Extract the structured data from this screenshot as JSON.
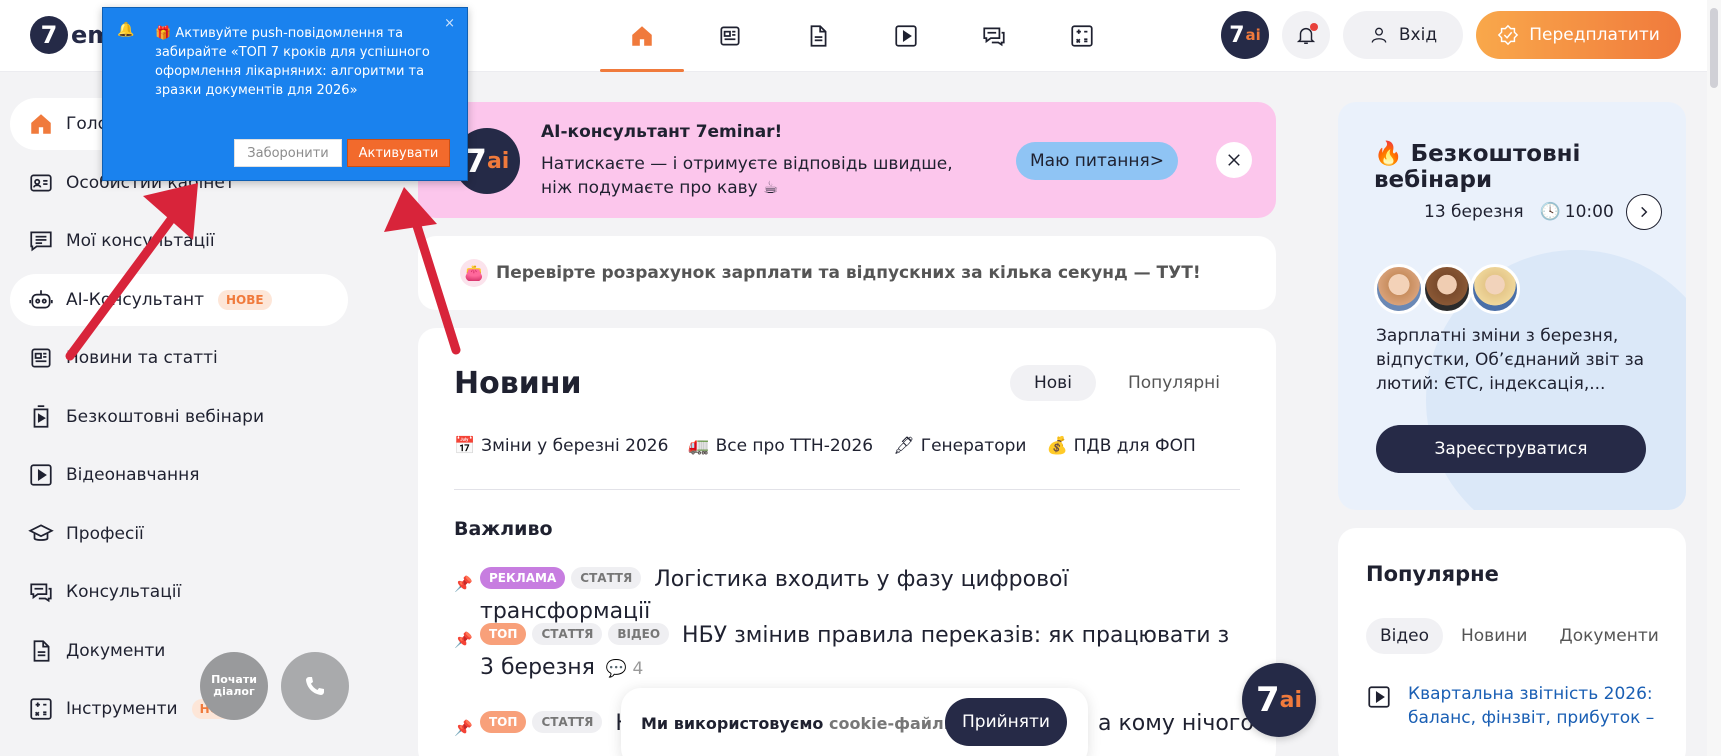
{
  "header": {
    "logo_mark": "7",
    "logo_text": "em",
    "ai_badge": "7",
    "ai_suffix": "ai",
    "login_label": "Вхід",
    "subscribe_label": "Передплатити",
    "accent": "#f07a3c"
  },
  "push": {
    "text": "🎁 Активуйте push-повідомлення та забирайте «ТОП 7 кроків для успішного оформлення лікарняних: алгоритми та зразки документів для 2026»",
    "close": "×",
    "deny": "Заборонити",
    "allow": "Активувати",
    "color": "#1a82ee"
  },
  "sidebar": {
    "items": [
      {
        "label": "Голо",
        "icon": "home-icon"
      },
      {
        "label": "Особистий кабінет",
        "icon": "id-card-icon"
      },
      {
        "label": "Мої консультації",
        "icon": "chat-list-icon"
      },
      {
        "label": "AI-Консультант",
        "icon": "robot-icon",
        "badge": "НОВЕ"
      },
      {
        "label": "Новини та статті",
        "icon": "news-icon"
      },
      {
        "label": "Безкоштовні вебінари",
        "icon": "webinar-icon"
      },
      {
        "label": "Відеонавчання",
        "icon": "video-icon"
      },
      {
        "label": "Професії",
        "icon": "graduation-icon"
      },
      {
        "label": "Консультації",
        "icon": "consult-icon"
      },
      {
        "label": "Документи",
        "icon": "document-icon"
      },
      {
        "label": "Інструменти",
        "icon": "tools-icon",
        "badge": "НОВЕ"
      }
    ]
  },
  "ai_banner": {
    "logo": "7",
    "logo_ai": "ai",
    "title": "AI-консультант 7eminar!",
    "text": "Натискаєте — і отримуєте відповідь швидше, ніж подумаєте про каву ☕",
    "button": "Маю питання>"
  },
  "calc_banner": {
    "text": "Перевірте розрахунок зарплати та відпускних за кілька секунд — ТУТ!"
  },
  "news": {
    "title": "Новини",
    "tabs": [
      "Нові",
      "Популярні"
    ],
    "topics": [
      {
        "emoji": "📅",
        "label": "Зміни у березні 2026"
      },
      {
        "emoji": "🚛",
        "label": "Все про ТТН-2026"
      },
      {
        "emoji": "🖋",
        "label": "Генератори"
      },
      {
        "emoji": "💰",
        "label": "ПДВ для ФОП"
      }
    ],
    "important_label": "Важливо",
    "items": [
      {
        "tags": [
          "РЕКЛАМА",
          "СТАТТЯ"
        ],
        "title": "Логістика входить у фазу цифрової трансформації"
      },
      {
        "tags": [
          "ТОП",
          "СТАТТЯ",
          "ВІДЕО"
        ],
        "title": "НБУ змінив правила переказів: як працювати з 3 березня",
        "comments": "4"
      },
      {
        "tags": [
          "ТОП",
          "СТАТТЯ"
        ],
        "title": "Н",
        "tail": "а кому нічого"
      }
    ]
  },
  "webinar": {
    "title": "🔥 Безкоштовні вебінари",
    "date": "13 березня",
    "time": "10:00",
    "description": "Зарплатні зміни з березня, відпустки, Об’єднаний звіт за лютий: ЄТС, індексація,...",
    "register": "Зареєструватися"
  },
  "popular": {
    "title": "Популярне",
    "tabs": [
      "Відео",
      "Новини",
      "Документи"
    ],
    "item": "Квартальна звітність 2026: баланс, фінзвіт, прибуток –"
  },
  "chat": {
    "start": "Почати діалог"
  },
  "cookie": {
    "text": "Ми використовуємо",
    "link": "cookie-файли",
    "accept": "Прийняти"
  },
  "float_ai": {
    "logo": "7",
    "logo_ai": "ai"
  }
}
